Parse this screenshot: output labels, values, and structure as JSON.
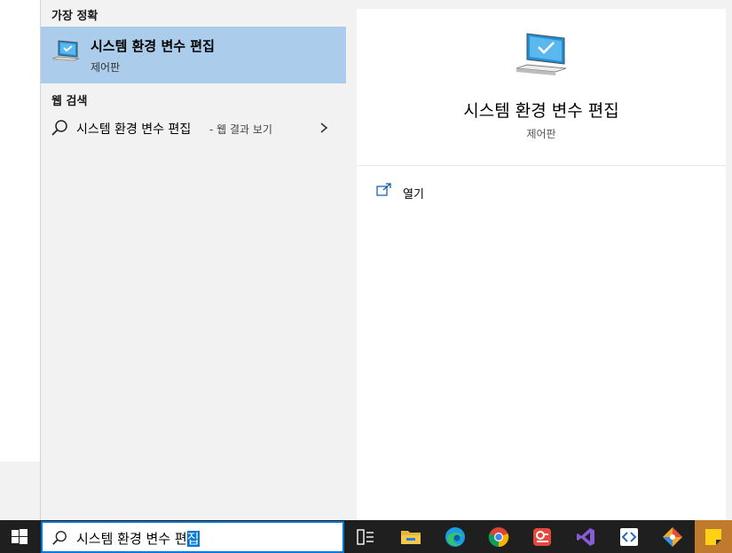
{
  "results": {
    "best_match_header": "가장 정확",
    "best_match": {
      "title": "시스템 환경 변수 편집",
      "subtitle": "제어판",
      "icon": "monitor-check-icon"
    },
    "web_header": "웹 검색",
    "web_result": {
      "query": "시스템 환경 변수 편집",
      "suffix": "- 웹 결과 보기",
      "icon": "search-icon"
    }
  },
  "preview": {
    "title": "시스템 환경 변수 편집",
    "subtitle": "제어판",
    "actions": [
      {
        "label": "열기",
        "icon": "open-external-icon"
      }
    ]
  },
  "taskbar": {
    "search_text": "시스템 환경 변수 편",
    "search_selected": "집",
    "apps": [
      "task-view-icon",
      "file-explorer-icon",
      "edge-icon",
      "chrome-icon",
      "powerpoint-like-icon",
      "visual-studio-icon",
      "code-editor-icon",
      "git-icon",
      "sticky-notes-icon"
    ]
  },
  "colors": {
    "selection": "#abcdeb",
    "accent": "#0078d7",
    "taskbar": "#1f1f1f",
    "panel": "#f2f2f2"
  }
}
